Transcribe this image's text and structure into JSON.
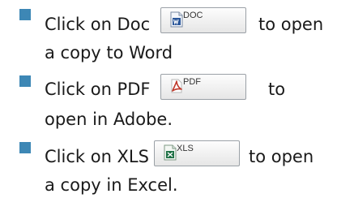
{
  "items": [
    {
      "line1_prefix": "Click on Doc",
      "line1_suffix": "to open",
      "line2": "a copy to Word",
      "button_label": "DOC",
      "icon": "word-doc-icon",
      "icon_color": "#2b579a"
    },
    {
      "line1_prefix": "Click on PDF",
      "line1_suffix": "to",
      "line2": "open in Adobe.",
      "button_label": "PDF",
      "icon": "pdf-icon",
      "icon_color": "#c0392b"
    },
    {
      "line1_prefix": "Click on XLS",
      "line1_suffix": "to open",
      "line2": "a copy in Excel.",
      "button_label": "XLS",
      "icon": "excel-xls-icon",
      "icon_color": "#1e7145"
    }
  ],
  "colors": {
    "bullet": "#3d87b5",
    "text": "#1a1a1a",
    "button_border": "#9aa0a6"
  }
}
